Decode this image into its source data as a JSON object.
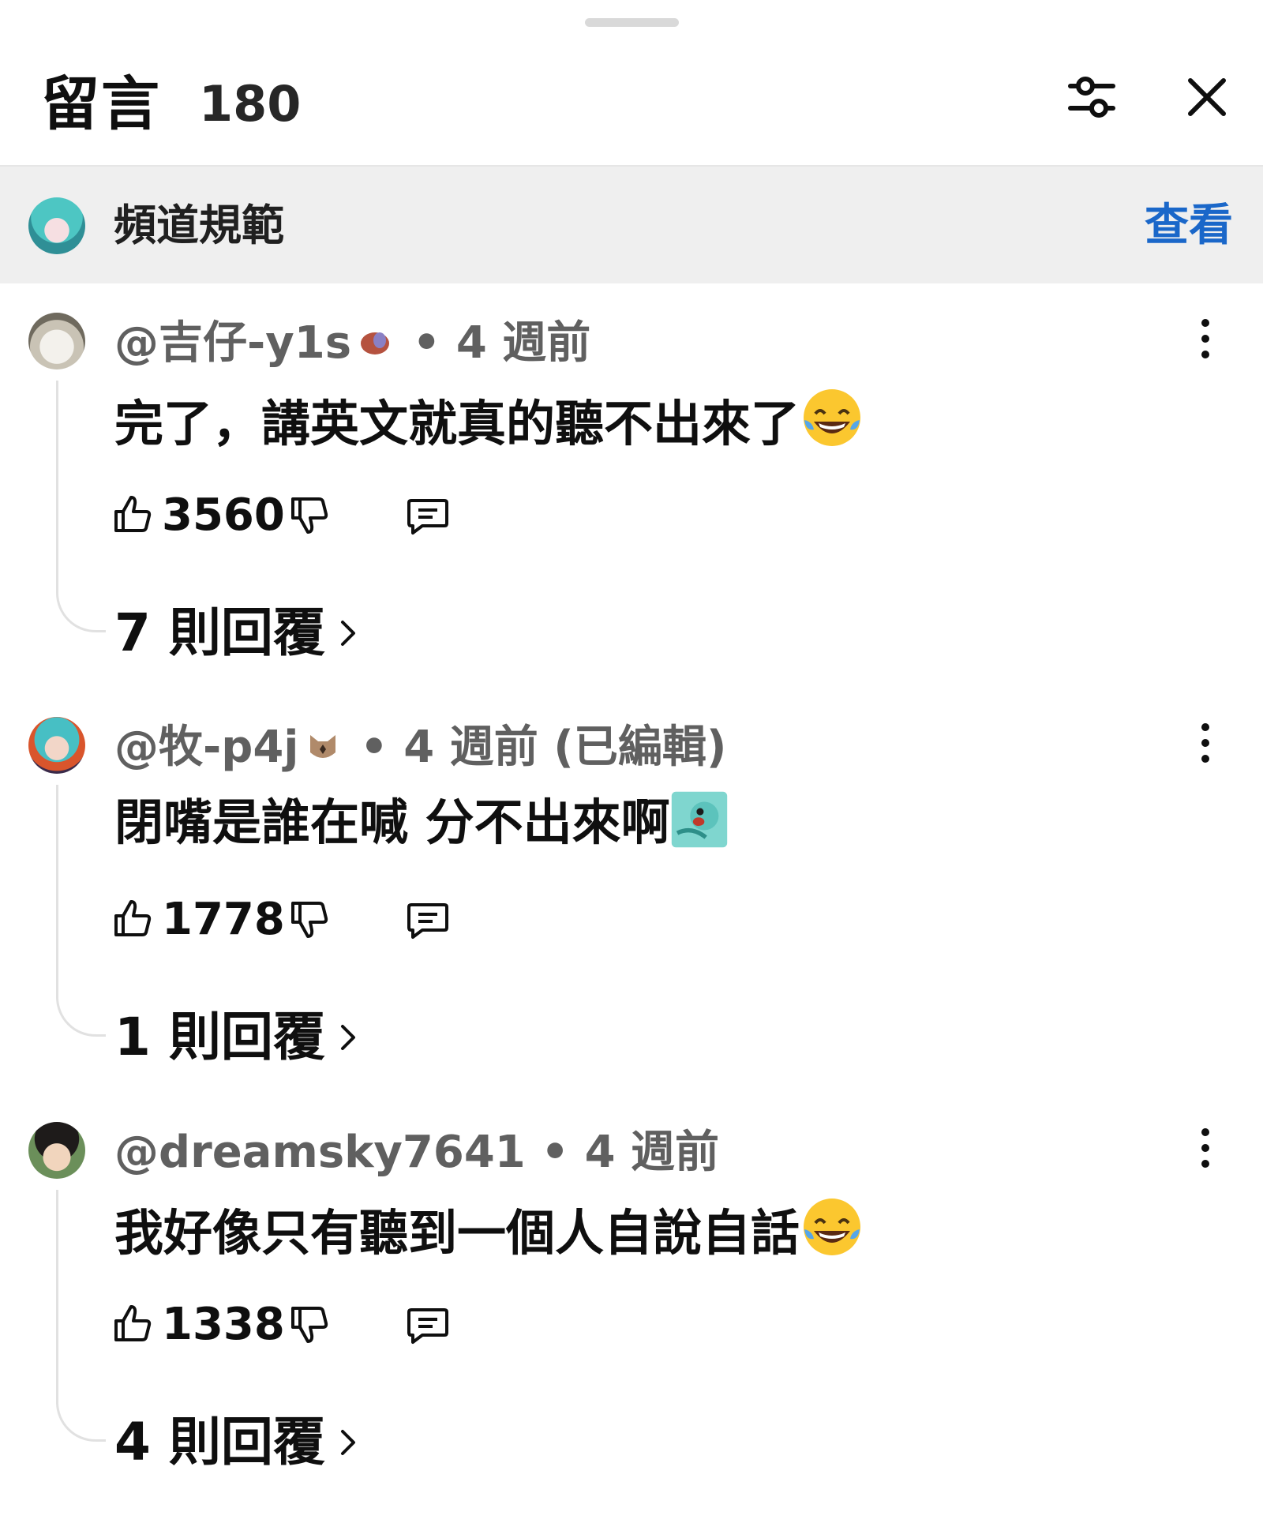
{
  "header": {
    "title": "留言",
    "count": "180"
  },
  "guidelines": {
    "label": "頻道規範",
    "link": "查看"
  },
  "comments": [
    {
      "author": "@吉仔-y1s",
      "time": "4 週前",
      "edited": "",
      "text": "完了，講英文就真的聽不出來了",
      "likes": "3560",
      "replies": "7 則回覆",
      "emoji": "tears-of-joy"
    },
    {
      "author": "@牧-p4j",
      "time": "4 週前",
      "edited": "(已編輯)",
      "text": "閉嘴是誰在喊 分不出來啊",
      "likes": "1778",
      "replies": "1 則回覆",
      "emoji": "custom-sticker"
    },
    {
      "author": "@dreamsky7641",
      "time": "4 週前",
      "edited": "",
      "text": "我好像只有聽到一個人自說自話",
      "likes": "1338",
      "replies": "4 則回覆",
      "emoji": "tears-of-joy"
    }
  ],
  "separator": "•",
  "colors": {
    "link": "#1a67c9",
    "meta": "#606060",
    "banner_bg": "#efefef"
  }
}
